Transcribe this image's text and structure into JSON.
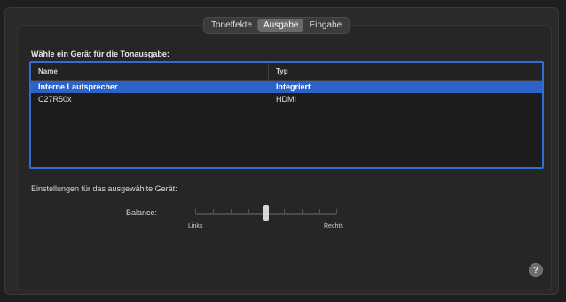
{
  "tabs": [
    {
      "label": "Toneffekte",
      "active": false
    },
    {
      "label": "Ausgabe",
      "active": true
    },
    {
      "label": "Eingabe",
      "active": false
    }
  ],
  "prompt": "Wähle ein Gerät für die Tonausgabe:",
  "table": {
    "columns": [
      "Name",
      "Typ"
    ],
    "rows": [
      {
        "name": "Interne Lautsprecher",
        "type": "Integriert",
        "selected": true
      },
      {
        "name": "C27R50x",
        "type": "HDMI",
        "selected": false
      }
    ]
  },
  "settings_label": "Einstellungen für das ausgewählte Gerät:",
  "balance": {
    "label": "Balance:",
    "left_label": "Links",
    "right_label": "Rechts",
    "value": 0.5
  },
  "help": {
    "glyph": "?",
    "icon": "help-icon"
  },
  "colors": {
    "accent": "#2d63c8",
    "selection": "#2d63c8"
  }
}
